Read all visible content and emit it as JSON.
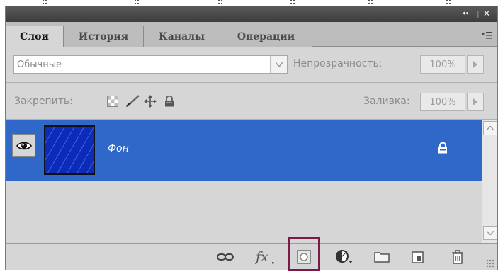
{
  "panel": {
    "title_controls": {
      "collapse": "◂◂",
      "close": "✕"
    },
    "tabs": [
      {
        "label": "Слои",
        "active": true
      },
      {
        "label": "История",
        "active": false
      },
      {
        "label": "Каналы",
        "active": false
      },
      {
        "label": "Операции",
        "active": false
      }
    ],
    "menu_icon": "panel-menu-icon"
  },
  "blend": {
    "value": "Обычные"
  },
  "opacity": {
    "label": "Непрозрачность:",
    "value": "100%"
  },
  "lock": {
    "label": "Закрепить:",
    "icons": [
      "lock-transparent-icon",
      "lock-image-icon",
      "lock-position-icon",
      "lock-all-icon"
    ]
  },
  "fill": {
    "label": "Заливка:",
    "value": "100%"
  },
  "layers": [
    {
      "name": "Фон",
      "visible": true,
      "locked": true,
      "selected": true
    }
  ],
  "bottom_icons": [
    "link-layers-icon",
    "fx-icon",
    "layer-mask-icon",
    "adjustment-layer-icon",
    "folder-icon",
    "new-layer-icon",
    "trash-icon"
  ],
  "colors": {
    "selection": "#2f68c8",
    "highlight_border": "#7a1a45",
    "panel_bg": "#d6d6d6"
  }
}
